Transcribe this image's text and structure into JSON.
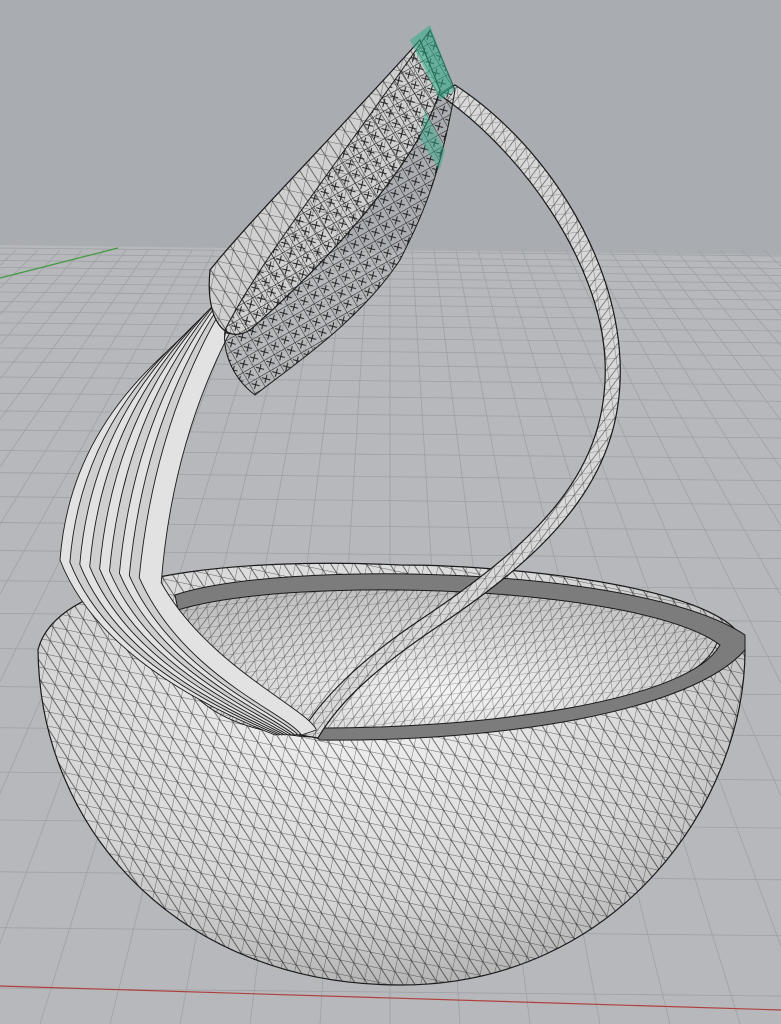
{
  "viewport": {
    "view": "Perspective",
    "display_mode": "shaded-wireframe",
    "background_color": "#a9acb0",
    "grid_color": "#b6b8bb",
    "grid_line_color": "#9ea1a5",
    "x_axis_color": "#b04040",
    "y_axis_color": "#3f9a3f",
    "mesh_fill_color": "#dcdcdc",
    "mesh_edge_color": "#1a1a1a",
    "highlight_color": "#2fae8c"
  },
  "scene": {
    "objects": [
      {
        "name": "hemisphere-bowl",
        "type": "mesh"
      },
      {
        "name": "twisted-ribbon-sculpture",
        "type": "mesh"
      },
      {
        "name": "lattice-frame",
        "type": "mesh"
      }
    ]
  }
}
